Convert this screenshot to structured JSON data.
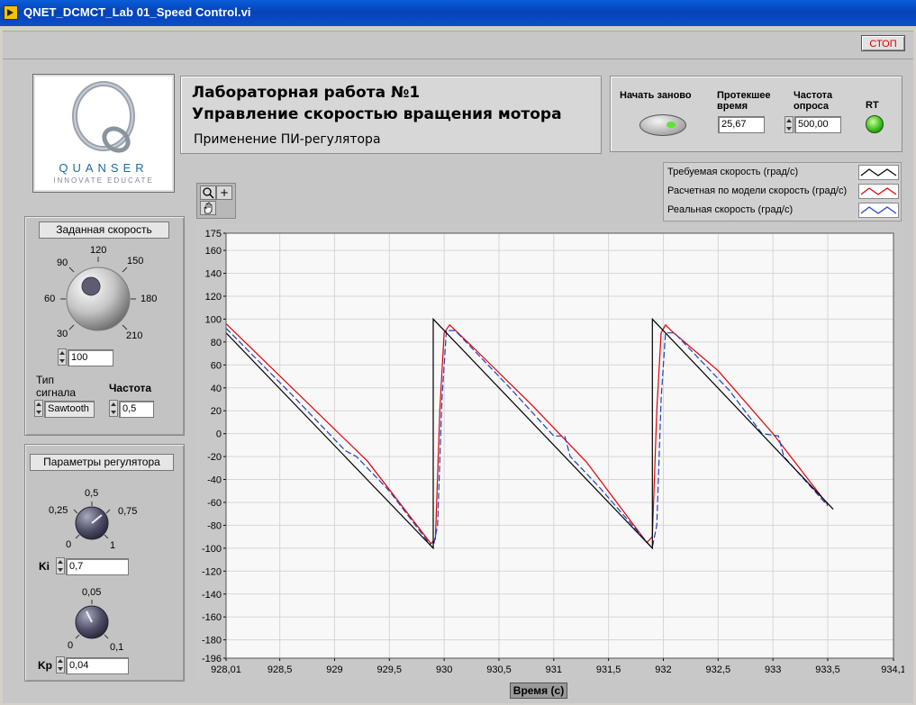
{
  "window": {
    "title": "QNET_DCMCT_Lab 01_Speed Control.vi"
  },
  "toolbar": {
    "stop_label": "СТОП"
  },
  "logo": {
    "brand": "QUANSER",
    "tagline": "INNOVATE EDUCATE"
  },
  "header": {
    "line1": "Лабораторная работа №1",
    "line2": "Управление скоростью вращения мотора",
    "subtitle": "Применение ПИ-регулятора"
  },
  "controls": {
    "restart_label": "Начать заново",
    "elapsed_label": "Протекшее время",
    "elapsed_value": "25,67",
    "rate_label": "Частота опроса",
    "rate_value": "500,00",
    "rt_label": "RT",
    "rt_color": "#29b20e"
  },
  "legend": [
    {
      "label": "Требуемая скорость (град/с)",
      "color": "#000000"
    },
    {
      "label": "Расчетная по модели скорость (град/с)",
      "color": "#e00000"
    },
    {
      "label": "Реальная скорость (град/с)",
      "color": "#1f3fbf"
    }
  ],
  "palette": {
    "zoom_icon": "zoom-icon",
    "cursor_icon": "crosshair-icon",
    "pan_icon": "hand-icon"
  },
  "setpoint_panel": {
    "title": "Заданная скорость",
    "dial_ticks": [
      "30",
      "60",
      "90",
      "120",
      "150",
      "180",
      "210"
    ],
    "dial_value": "100",
    "signal_type_label": "Тип сигнала",
    "signal_type_value": "Sawtooth",
    "frequency_label": "Частота",
    "frequency_value": "0,5"
  },
  "regulator_panel": {
    "title": "Параметры регулятора",
    "ki_ticks": [
      "0",
      "0,25",
      "0,5",
      "0,75",
      "1"
    ],
    "ki_label": "Ki",
    "ki_value": "0,7",
    "kp_ticks": [
      "0",
      "0,05",
      "0,1"
    ],
    "kp_label": "Kp",
    "kp_value": "0,04"
  },
  "chart_data": {
    "type": "line",
    "xlabel": "Время (с)",
    "ylabel": "",
    "xlim": [
      928.01,
      934.1
    ],
    "ylim": [
      -196,
      175
    ],
    "x_ticks": [
      928.01,
      928.5,
      929,
      929.5,
      930,
      930.5,
      931,
      931.5,
      932,
      932.5,
      933,
      933.5,
      934.1
    ],
    "x_tick_labels": [
      "928,01",
      "928,5",
      "929",
      "929,5",
      "930",
      "930,5",
      "931",
      "931,5",
      "932",
      "932,5",
      "933",
      "933,5",
      "934,1"
    ],
    "y_ticks": [
      175,
      160,
      140,
      120,
      100,
      80,
      60,
      40,
      20,
      0,
      -20,
      -40,
      -60,
      -80,
      -100,
      -120,
      -140,
      -160,
      -180,
      -196
    ],
    "y_tick_labels": [
      "175",
      "160",
      "140",
      "120",
      "100",
      "80",
      "60",
      "40",
      "20",
      "0",
      "-20",
      "-40",
      "-60",
      "-80",
      "-100",
      "-120",
      "-140",
      "-160",
      "-180",
      "-196"
    ],
    "grid": true,
    "series": [
      {
        "name": "Требуемая скорость (град/с)",
        "color": "#000000",
        "x": [
          928.01,
          929.9,
          929.9,
          931.9,
          931.9,
          933.55
        ],
        "y": [
          88,
          -100,
          100,
          -100,
          100,
          -66
        ]
      },
      {
        "name": "Расчетная по модели скорость (град/с)",
        "color": "#e00000",
        "x": [
          928.01,
          929.3,
          929.88,
          929.92,
          929.96,
          930.0,
          930.05,
          930.3,
          930.8,
          931.3,
          931.85,
          931.9,
          931.94,
          931.98,
          932.02,
          932.07,
          932.5,
          933.0,
          933.5
        ],
        "y": [
          96,
          -24,
          -96,
          -92,
          20,
          88,
          95,
          72,
          25,
          -25,
          -95,
          -90,
          20,
          88,
          95,
          90,
          55,
          0,
          -62
        ]
      },
      {
        "name": "Реальная скорость (град/с)",
        "color": "#1f3fbf",
        "x": [
          928.01,
          928.6,
          928.9,
          929.05,
          929.1,
          929.2,
          929.5,
          929.89,
          929.9,
          929.94,
          929.98,
          930.02,
          930.1,
          930.6,
          931.0,
          931.1,
          931.15,
          931.4,
          931.89,
          931.9,
          931.94,
          931.98,
          932.02,
          932.1,
          932.6,
          932.9,
          933.05,
          933.1,
          933.5
        ],
        "y": [
          92,
          35,
          5,
          -10,
          -15,
          -20,
          -50,
          -99,
          -99,
          -80,
          30,
          90,
          90,
          40,
          -2,
          -2,
          -20,
          -45,
          -99,
          -99,
          -80,
          30,
          88,
          88,
          38,
          0,
          -2,
          -20,
          -63
        ]
      }
    ]
  }
}
